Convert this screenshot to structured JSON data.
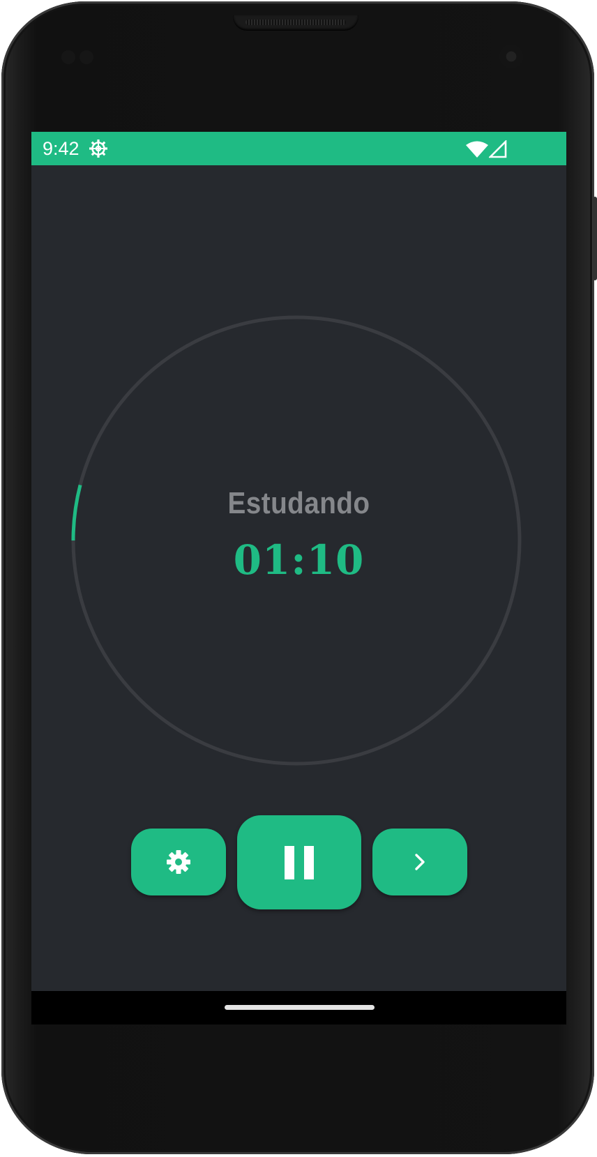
{
  "status_bar": {
    "time": "9:42",
    "settings_icon": "gear-outline-icon",
    "wifi_icon": "wifi-icon",
    "signal_icon": "cell-signal-icon",
    "background_color": "#1fbb84"
  },
  "timer": {
    "phase_label": "Estudando",
    "remaining_time": "01:10",
    "progress_fraction": 0.04,
    "track_color": "#3a3c41",
    "progress_color": "#1fbb84"
  },
  "controls": {
    "settings_button_icon": "gear-icon",
    "pause_button_icon": "pause-icon",
    "skip_button_icon": "chevron-right-icon",
    "accent_color": "#1fbb84"
  },
  "theme": {
    "screen_background": "#26292e",
    "label_color": "#85878b"
  }
}
